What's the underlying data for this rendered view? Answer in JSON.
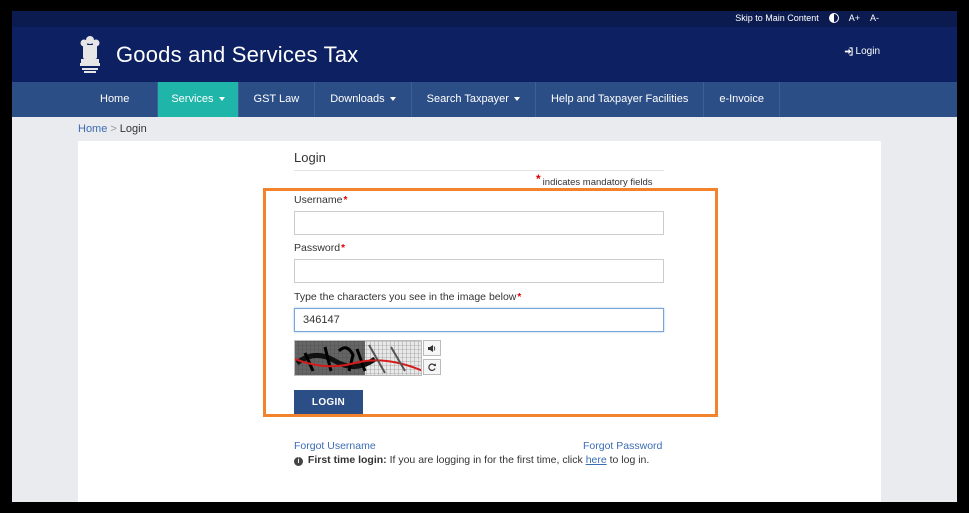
{
  "utility_bar": {
    "skip_link": "Skip to Main Content",
    "font_increase": "A+",
    "font_decrease": "A-"
  },
  "header": {
    "title": "Goods and Services Tax",
    "login_link": "Login",
    "colors": {
      "utility": "#0b1b4f",
      "header": "#0d2061",
      "nav": "#2c4e86",
      "nav_active": "#1fb5a8"
    }
  },
  "nav": {
    "items": [
      {
        "label": "Home"
      },
      {
        "label": "Services"
      },
      {
        "label": "GST Law"
      },
      {
        "label": "Downloads"
      },
      {
        "label": "Search Taxpayer"
      },
      {
        "label": "Help and Taxpayer Facilities"
      },
      {
        "label": "e-Invoice"
      }
    ]
  },
  "breadcrumb": {
    "home": "Home",
    "separator": ">",
    "current": "Login"
  },
  "form": {
    "heading": "Login",
    "mandatory_note": "indicates mandatory fields",
    "required_mark": "*",
    "username_label": "Username",
    "username_value": "",
    "password_label": "Password",
    "password_value": "",
    "captcha_label": "Type the characters you see in the image below",
    "captcha_value": "346147",
    "login_button": "LOGIN",
    "forgot_username": "Forgot Username",
    "forgot_password": "Forgot Password",
    "first_time_label": "First time login:",
    "first_time_text": "If you are logging in for the first time, click",
    "here_link": "here",
    "first_time_suffix": "to log in.",
    "highlight_color": "#f2822b"
  },
  "icons": {
    "emblem": "national-emblem-icon",
    "login": "sign-in-icon",
    "contrast": "contrast-icon",
    "audio": "speaker-icon",
    "refresh": "refresh-icon",
    "info": "info-circle-icon"
  }
}
